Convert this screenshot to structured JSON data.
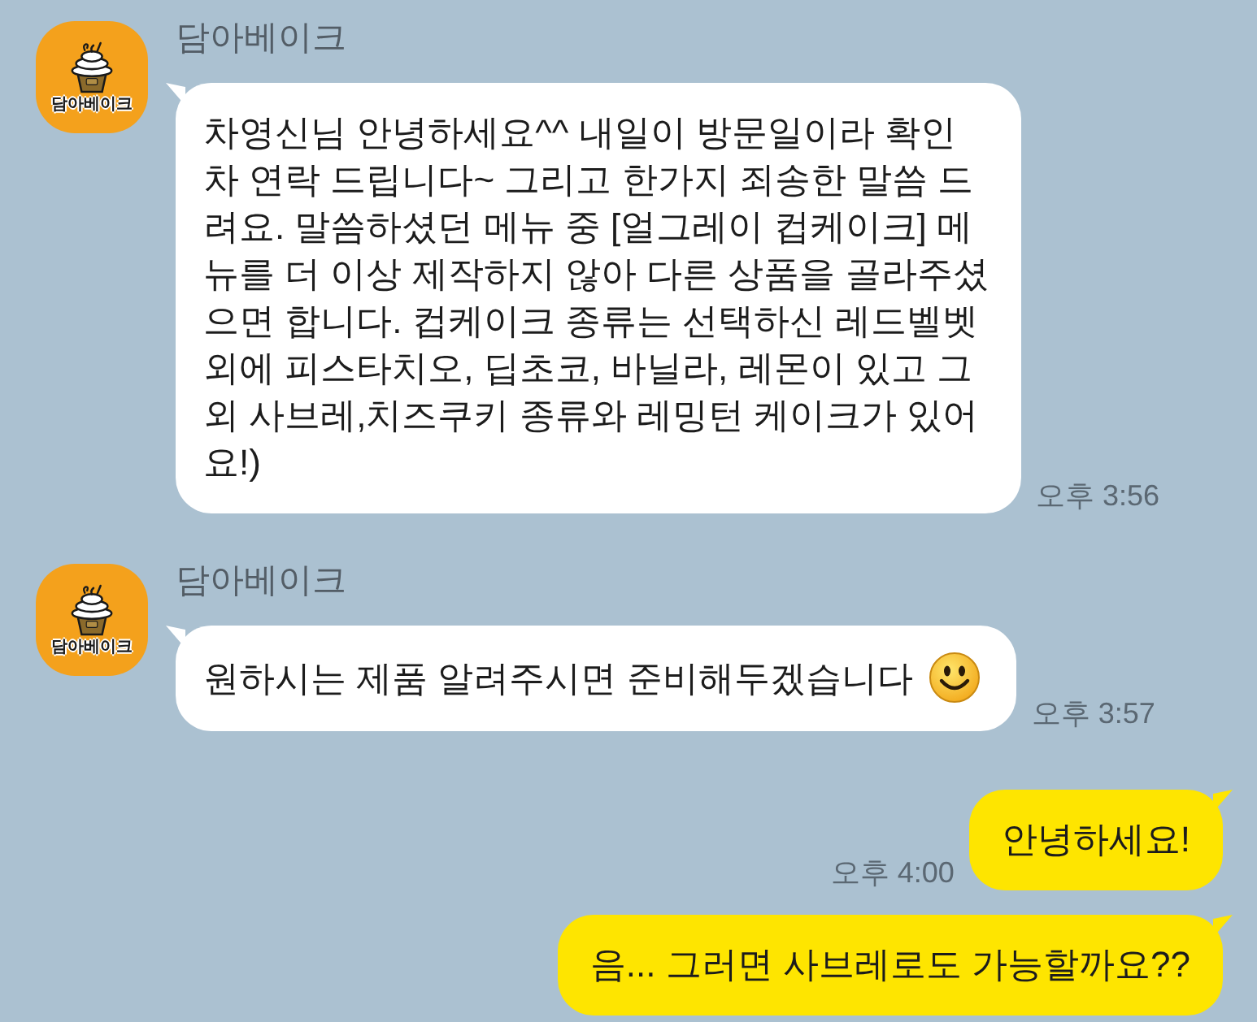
{
  "chat": [
    {
      "kind": "received",
      "sender": "담아베이크",
      "avatar_label": "담아베이크",
      "text": "차영신님 안녕하세요^^ 내일이 방문일이라 확인 차 연락 드립니다~ 그리고 한가지 죄송한 말씀 드려요. 말씀하셨던 메뉴 중 [얼그레이 컵케이크] 메뉴를 더 이상 제작하지 않아 다른 상품을 골라주셨으면 합니다. 컵케이크 종류는 선택하신 레드벨벳 외에 피스타치오, 딥초코, 바닐라, 레몬이 있고 그 외 사브레,치즈쿠키 종류와 레밍턴 케이크가 있어요!)",
      "emoji": false,
      "time": "오후 3:56"
    },
    {
      "kind": "received",
      "sender": "담아베이크",
      "avatar_label": "담아베이크",
      "text": "원하시는 제품 알려주시면 준비해두겠습니다",
      "emoji": true,
      "time": "오후 3:57"
    },
    {
      "kind": "sent",
      "text": "안녕하세요!",
      "emoji": false,
      "time": "오후 4:00"
    },
    {
      "kind": "sent",
      "text": "음... 그러면 사브레로도 가능할까요??",
      "emoji": false
    }
  ]
}
